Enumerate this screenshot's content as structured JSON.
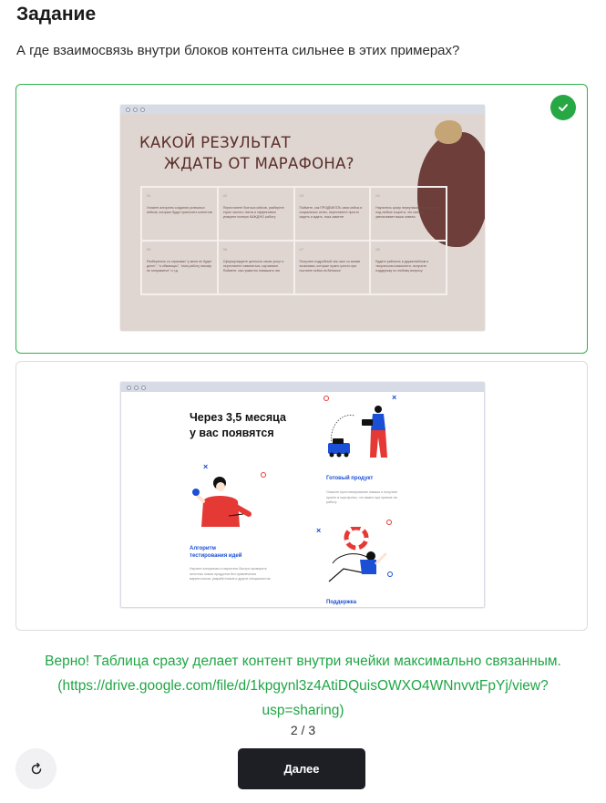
{
  "header": {
    "title": "Задание",
    "question": "А где взаимосвязь внутри блоков контента сильнее в этих примерах?"
  },
  "options": [
    {
      "selected": true,
      "correct": true,
      "status_icon": "check-icon",
      "slide": {
        "title_line1": "КАКОЙ РЕЗУЛЬТАТ",
        "title_line2": "ЖДАТЬ ОТ МАРАФОНА?",
        "cells": [
          {
            "num": "01",
            "text": "Узнаете алгоритм создания успешных кейсов, которые будут приносить клиентов"
          },
          {
            "num": "02",
            "text": "Перестанете бояться кейсов, разберете страх чистого листа и эффективно упакуете полную КАЖДУЮ работу"
          },
          {
            "num": "03",
            "text": "Поймете, как ПРОДВИГАТЬ свои кейсы в социальных сетях, перестанете просто сидеть и ждать, пока заметят"
          },
          {
            "num": "04",
            "text": "Научитесь сразу переупаковывать кейсы под любые соцсети, что сильно увеличивает ваши охваты"
          },
          {
            "num": "05",
            "text": "Разберетесь со страхами \"у меня не будет денег\", \"я обманщик\", \"мою работу никому не понравится\" и т.д."
          },
          {
            "num": "06",
            "text": "Сформулируете ценность своих услуг и перестанете извиняться, изучаемое. Поймете, как грамотно повышать чек"
          },
          {
            "num": "07",
            "text": "Получите подробный чек-лист со всеми экскизами, которые нужно учесть при постинге кейса на Behance"
          },
          {
            "num": "08",
            "text": "Будете работать в дружелюбном и творческом комьюнити, получите поддержку по любому вопросу"
          }
        ]
      }
    },
    {
      "selected": false,
      "correct": false,
      "slide": {
        "heading_line1": "Через 3,5 месяца",
        "heading_line2": "у вас появятся",
        "label_product": "Готовый продукт",
        "text_product": "Освоите прототипирование навыки и получите проект в портфолио, что важно при приеме на работу",
        "label_algorithm_1": "Алгоритм",
        "label_algorithm_2": "тестирования идей",
        "text_algorithm": "Изучите алгоритмы и научитесь быстро проверять гипотезы новых продуктов без привлечения маркетологов, разработчиков и других специалистов",
        "label_support": "Поддержка"
      }
    }
  ],
  "feedback": {
    "line1": "Верно! Таблица сразу делает контент внутри ячейки максимально связанным.",
    "line2": "(https://drive.google.com/file/d/1kpgynl3z4AtiDQuisOWXO4WNnvvtFpYj/view?",
    "line3": "usp=sharing)"
  },
  "pagination": {
    "text": "2 / 3"
  },
  "controls": {
    "reload_icon": "reload-icon",
    "next_label": "Далее"
  },
  "colors": {
    "accent_green": "#28a745",
    "feedback_green": "#1fa645",
    "button_dark": "#1e1f24",
    "slide1_bg": "#e0d6d1",
    "slide1_brown": "#6d3e3a",
    "slide2_blue": "#1a4fd6",
    "slide2_red": "#e53935"
  }
}
